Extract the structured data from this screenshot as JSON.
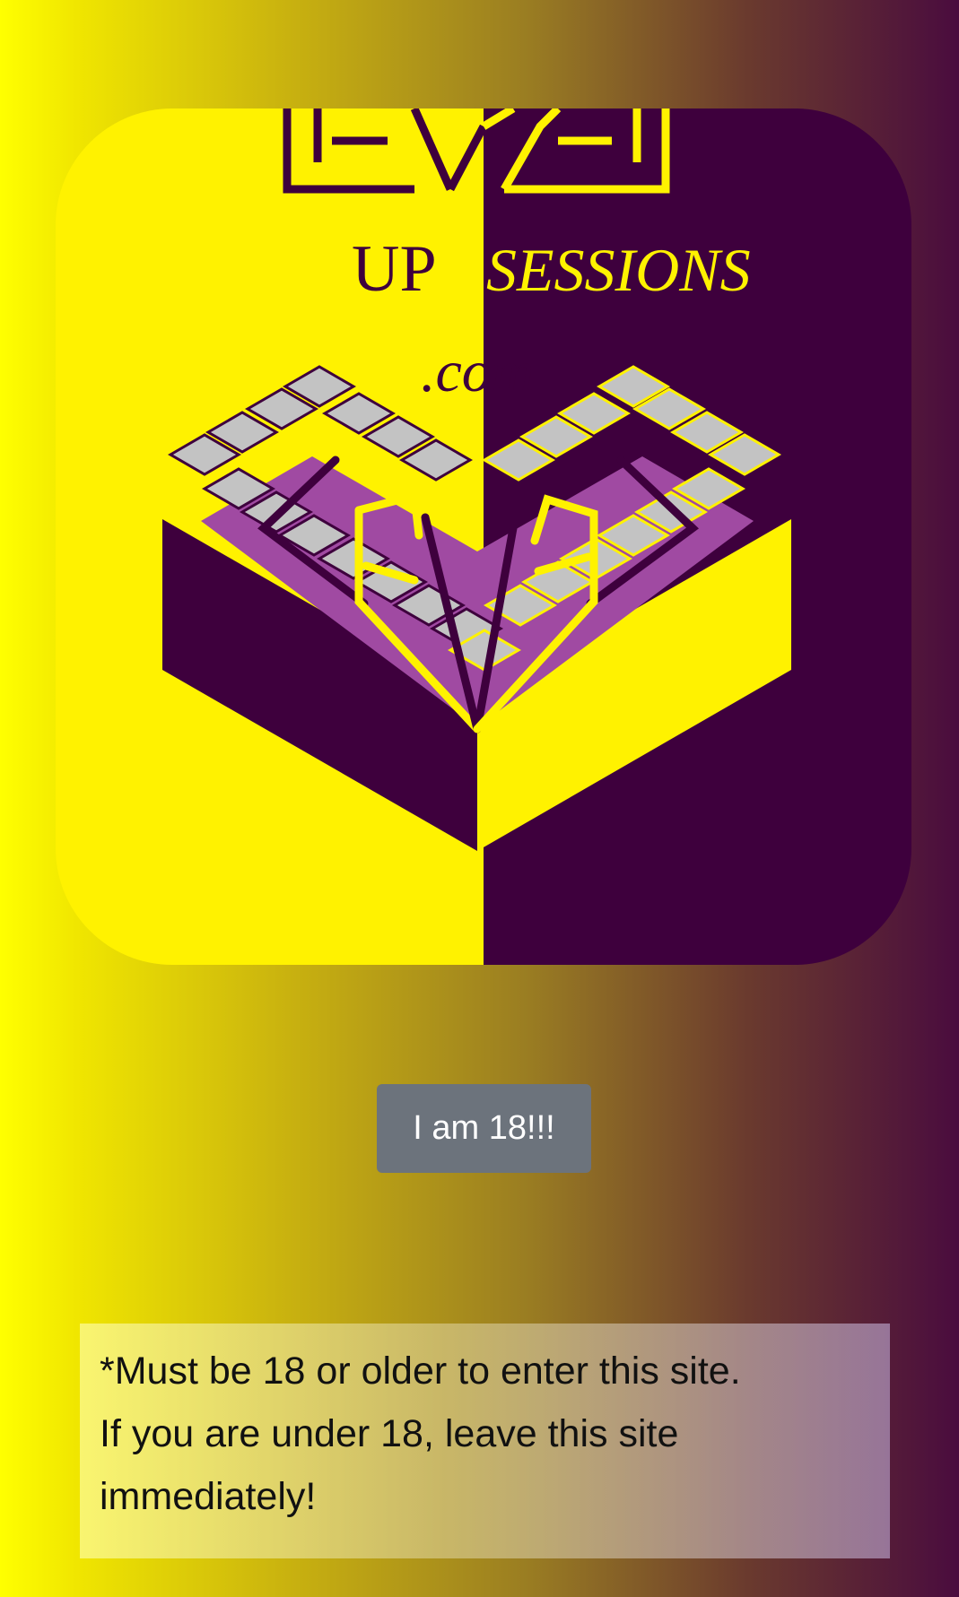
{
  "logo": {
    "brand_word_1": "UP",
    "brand_word_2": "SESSIONS",
    "brand_suffix": ".com",
    "top_lettering": "LEVEL",
    "colors": {
      "yellow": "#fff200",
      "purple_dark": "#3e003d",
      "purple_mid": "#a04aa2",
      "step_gray": "#c3c3c3"
    }
  },
  "age_gate": {
    "button_label": "I am 18!!!"
  },
  "notice": {
    "line1": "*Must be 18 or older to enter this site.",
    "line2": "If you are under 18, leave this site",
    "line3": "immediately!"
  },
  "colors": {
    "button_bg": "#6c737c",
    "gradient_left": "#ffff00",
    "gradient_right": "#4a0c3e"
  }
}
